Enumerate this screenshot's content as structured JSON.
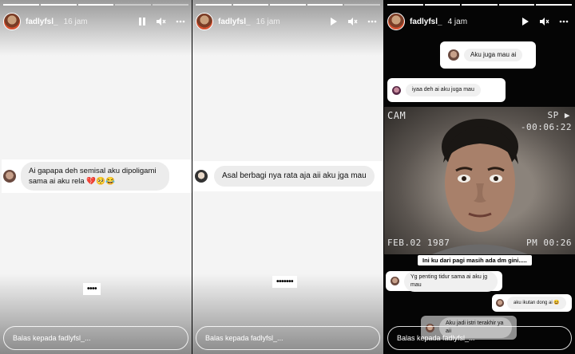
{
  "stories": [
    {
      "username": "fadlyfsl_",
      "time": "16 jam",
      "message": "Ai gapapa deh semisal aku dipoligami sama ai aku rela 💔🥺😂",
      "dots": "••••",
      "reply_placeholder": "Balas kepada fadlyfsl_..."
    },
    {
      "username": "fadlyfsl_",
      "time": "16 jam",
      "message": "Asal berbagi nya rata aja aii aku jga mau",
      "dots": "•••••••",
      "reply_placeholder": "Balas kepada fadlyfsl_..."
    },
    {
      "username": "fadlyfsl_",
      "time": "4 jam",
      "card1": "Aku juga mau ai",
      "card2": "iyaa deh ai aku juga mau",
      "cam_label": "CAM",
      "cam_sp": "SP ▶",
      "cam_timer": "-00:06:22",
      "cam_date": "FEB.02 1987",
      "cam_time": "PM 00:26",
      "caption": "Ini ku dari pagi masih ada dm gini.....",
      "card3": "Yg penting tidur sama ai aku jg mau",
      "card4": "aku ikutan dong ai 😆",
      "card5": "Aku jadi istri terakhir ya aii",
      "reply_placeholder": "Balas kepada fadlyfsl_..."
    }
  ],
  "colors": {
    "panel_bg": "#f4f4f4",
    "dark_bg": "#050505",
    "bubble": "#ececec",
    "heart": "#e0245e"
  }
}
